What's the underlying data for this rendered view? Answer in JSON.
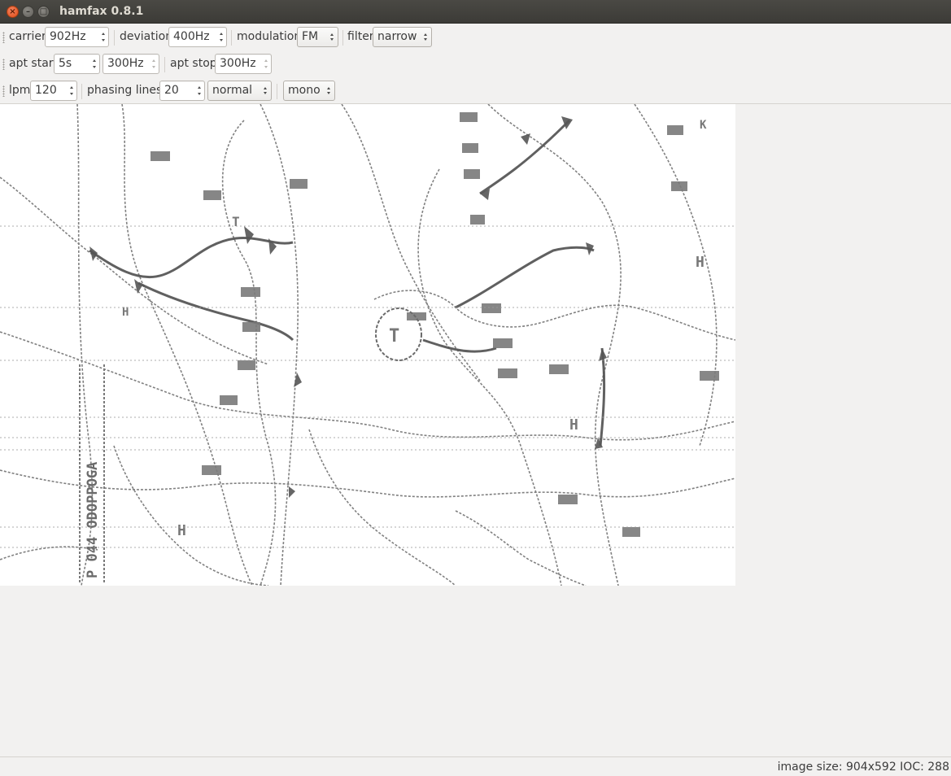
{
  "window": {
    "title": "hamfax 0.8.1",
    "close_glyph": "×",
    "minimize_glyph": "–",
    "maximize_glyph": "□"
  },
  "toolbar1": {
    "carrier_label": "carrier",
    "carrier_value": "902Hz",
    "deviation_label": "deviation",
    "deviation_value": "400Hz",
    "modulation_label": "modulation",
    "modulation_value": "FM",
    "filter_label": "filter",
    "filter_value": "narrow"
  },
  "toolbar2": {
    "apt_start_label": "apt start",
    "apt_start_time": "5s",
    "apt_start_freq": "300Hz",
    "apt_stop_label": "apt stop",
    "apt_stop_freq": "300Hz"
  },
  "toolbar3": {
    "lpm_label": "lpm",
    "lpm_value": "120",
    "phasing_label": "phasing lines",
    "phasing_value": "20",
    "phasing_mode": "normal",
    "color_mode": "mono"
  },
  "image": {
    "description_visible_text": "P 044 ODOPPOGA"
  },
  "status": {
    "text": "image size: 904x592  IOC: 288"
  },
  "colors": {
    "window_bg": "#f2f1f0",
    "titlebar": "#3c3b37",
    "close_button": "#df4a16",
    "fax_bg": "#ffffff",
    "fax_ink": "#555555"
  }
}
